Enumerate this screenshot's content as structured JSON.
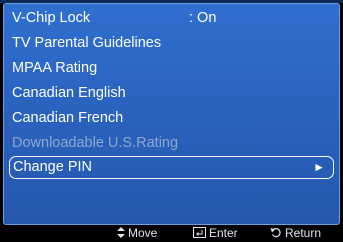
{
  "menu": {
    "items": [
      {
        "label": "V-Chip Lock",
        "value": ": On"
      },
      {
        "label": "TV Parental Guidelines"
      },
      {
        "label": "MPAA Rating"
      },
      {
        "label": "Canadian English"
      },
      {
        "label": "Canadian French"
      },
      {
        "label": "Downloadable U.S.Rating",
        "state": "disabled"
      },
      {
        "label": "Change PIN",
        "state": "selected",
        "arrow": "►"
      }
    ]
  },
  "footer": {
    "move_label": "Move",
    "enter_label": "Enter",
    "return_label": "Return",
    "move_icon": "updown-arrow-icon",
    "enter_icon": "enter-icon",
    "return_icon": "return-icon"
  },
  "colors": {
    "panel_blue": "#2a63c0",
    "panel_border": "#6f9ee0",
    "text": "#ffffff",
    "disabled_text": "#8fa7cc",
    "background": "#000000"
  }
}
